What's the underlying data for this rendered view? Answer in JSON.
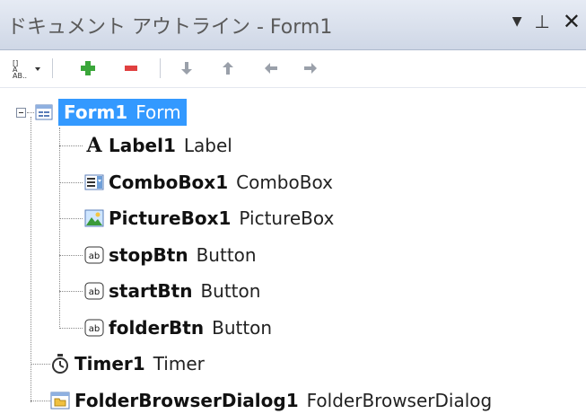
{
  "window": {
    "title": "ドキュメント アウトライン - Form1",
    "controls": {
      "dropdown_glyph": "▼",
      "pin_glyph": "⊥",
      "close_glyph": "✕"
    }
  },
  "toolbar": {
    "view_selector_label": "ab..",
    "add_glyph": "+",
    "remove_glyph": "−",
    "arrows": [
      "↓",
      "↑",
      "←",
      "→"
    ]
  },
  "tree": {
    "root": {
      "name": "Form1",
      "type": "Form",
      "icon": "form-icon",
      "selected": true
    },
    "children": [
      {
        "name": "Label1",
        "type": "Label",
        "icon": "label-icon"
      },
      {
        "name": "ComboBox1",
        "type": "ComboBox",
        "icon": "combobox-icon"
      },
      {
        "name": "PictureBox1",
        "type": "PictureBox",
        "icon": "picturebox-icon"
      },
      {
        "name": "stopBtn",
        "type": "Button",
        "icon": "button-icon"
      },
      {
        "name": "startBtn",
        "type": "Button",
        "icon": "button-icon"
      },
      {
        "name": "folderBtn",
        "type": "Button",
        "icon": "button-icon"
      }
    ],
    "components": [
      {
        "name": "Timer1",
        "type": "Timer",
        "icon": "timer-icon"
      },
      {
        "name": "FolderBrowserDialog1",
        "type": "FolderBrowserDialog",
        "icon": "folder-browser-icon"
      }
    ]
  },
  "colors": {
    "selection": "#3399ff",
    "add": "#3aa63a",
    "remove": "#e04040",
    "arrow": "#9aa0aa"
  }
}
